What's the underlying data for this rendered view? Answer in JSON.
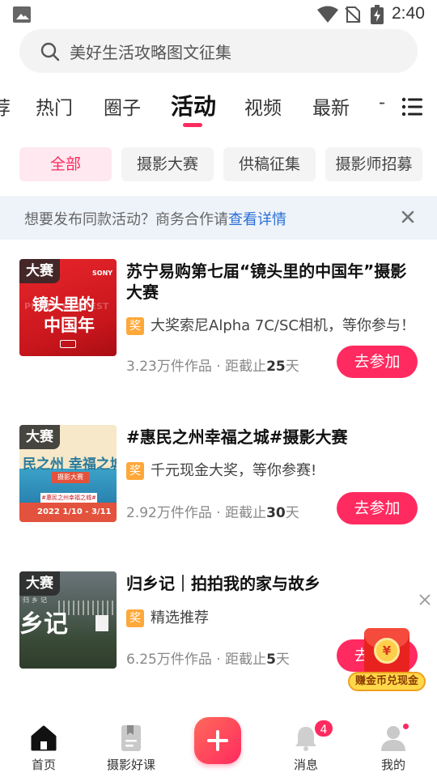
{
  "status_bar": {
    "time": "2:40"
  },
  "search": {
    "placeholder": "美好生活攻略图文征集"
  },
  "tabs": [
    {
      "label": "荐",
      "active": false
    },
    {
      "label": "热门",
      "active": false
    },
    {
      "label": "圈子",
      "active": false
    },
    {
      "label": "活动",
      "active": true
    },
    {
      "label": "视频",
      "active": false
    },
    {
      "label": "最新",
      "active": false
    },
    {
      "label": "-",
      "active": false
    }
  ],
  "filters": [
    {
      "label": "全部",
      "active": true
    },
    {
      "label": "摄影大赛",
      "active": false
    },
    {
      "label": "供稿征集",
      "active": false
    },
    {
      "label": "摄影师招募",
      "active": false
    }
  ],
  "banner": {
    "text": "想要发布同款活动？商务合作请",
    "link": "查看详情"
  },
  "cards": [
    {
      "badge": "大赛",
      "title": "苏宁易购第七届“镜头里的中国年”摄影大赛",
      "perk_badge": "奖",
      "perk": "大奖索尼Alpha 7C/SC相机，等你参与！",
      "works": "3.23万件作品 · 距截止",
      "days": "25",
      "days_unit": "天",
      "button": "去参加",
      "thumb_text": {
        "brand": "SONY",
        "main": "镜头里的",
        "sub": "中国年",
        "ghost": "PHOTO CONTEST"
      }
    },
    {
      "badge": "大赛",
      "title": "#惠民之州幸福之城#摄影大赛",
      "perk_badge": "奖",
      "perk": "千元现金大奖，等你参赛!",
      "works": "2.92万件作品 · 距截止",
      "days": "30",
      "days_unit": "天",
      "button": "去参加",
      "thumb_text": {
        "a": "民之州 幸福之城",
        "b": "摄影大赛",
        "c": "#惠民之州幸福之城#",
        "date": "2022 1/10 - 3/11"
      }
    },
    {
      "badge": "大赛",
      "title": "归乡记｜拍拍我的家与故乡",
      "perk_badge": "奖",
      "perk": "精选推荐",
      "works": "6.25万件作品 · 距截止",
      "days": "5",
      "days_unit": "天",
      "button": "去参加",
      "thumb_text": {
        "a": "乡记",
        "b": "归乡记"
      }
    }
  ],
  "float_ad": {
    "coin": "¥",
    "label": "赚金币兑现金"
  },
  "bottom_nav": [
    {
      "label": "首页",
      "icon": "home-icon"
    },
    {
      "label": "摄影好课",
      "icon": "bookmark-book-icon"
    },
    {
      "label": "",
      "icon": "plus-icon"
    },
    {
      "label": "消息",
      "icon": "bell-icon",
      "badge": "4"
    },
    {
      "label": "我的",
      "icon": "user-icon"
    }
  ],
  "colors": {
    "accent": "#ff2a5f",
    "link": "#2a6fd6",
    "banner_bg": "#eef3fa",
    "perk_badge": "#ffa83a"
  }
}
